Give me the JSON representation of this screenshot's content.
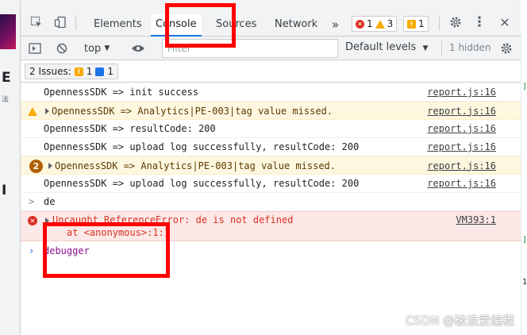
{
  "left_strip": {
    "glyph_1": "E",
    "glyph_2": "法",
    "glyph_3": "I"
  },
  "right_strip": {
    "mark_1": "]",
    "mark_2": "]",
    "mark_3": "1"
  },
  "tabs": [
    {
      "label": "Elements"
    },
    {
      "label": "Console",
      "active": true
    },
    {
      "label": "Sources"
    },
    {
      "label": "Network"
    }
  ],
  "overflow_label": "»",
  "badges": {
    "errors": "1",
    "warnings": "3",
    "issues": "1"
  },
  "toolbar": {
    "context": "top",
    "filter_placeholder": "Filter",
    "levels": "Default levels",
    "hidden": "1 hidden"
  },
  "issues": {
    "label": "2 Issues:",
    "warn_count": "1",
    "info_count": "1"
  },
  "log": [
    {
      "type": "log",
      "message": "OpennessSDK => init success",
      "source": "report.js:16"
    },
    {
      "type": "warn",
      "message": "OpennessSDK => Analytics|PE-003|tag value missed.",
      "source": "report.js:16"
    },
    {
      "type": "log",
      "message": "OpennessSDK => resultCode: 200",
      "source": "report.js:16"
    },
    {
      "type": "log",
      "message": "OpennessSDK => upload log successfully, resultCode: 200",
      "source": "report.js:16"
    },
    {
      "type": "warn-group",
      "count": "2",
      "message": "OpennessSDK => Analytics|PE-003|tag value missed.",
      "source": "report.js:16"
    },
    {
      "type": "log",
      "message": "OpennessSDK => upload log successfully, resultCode: 200",
      "source": "report.js:16"
    },
    {
      "type": "input",
      "message": "de"
    },
    {
      "type": "error",
      "message": "Uncaught ReferenceError: de is not defined",
      "message2": "at <anonymous>:1:1",
      "source": "VM393:1"
    },
    {
      "type": "prompt",
      "message": "debugger"
    }
  ],
  "watermark": "CSDN @破浪爱编程",
  "colors": {
    "highlight": "#ff0000",
    "accent": "#1a73e8",
    "error": "#d93025",
    "warning": "#f9ab00"
  }
}
